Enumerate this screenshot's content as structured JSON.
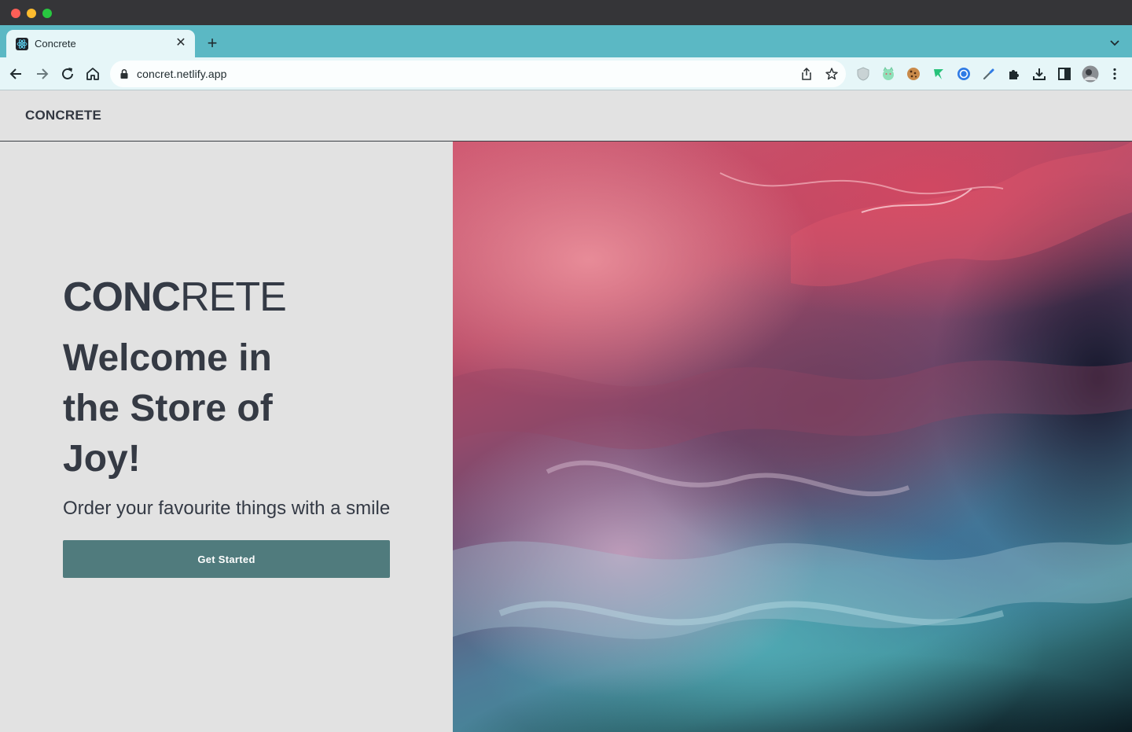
{
  "browser": {
    "tab_title": "Concrete",
    "url": "concret.netlify.app",
    "theme_color": "#5bb8c4"
  },
  "icons": {
    "tab_favicon": "react-atom-icon",
    "tab_close": "close-icon",
    "new_tab": "plus-icon",
    "tab_search": "chevron-down-icon",
    "back": "arrow-left-icon",
    "forward": "arrow-right-icon",
    "reload": "reload-icon",
    "home": "home-icon",
    "lock": "lock-icon",
    "share": "share-icon",
    "bookmark": "star-icon",
    "extensions": [
      "shield-extension-icon",
      "cat-extension-icon",
      "cookie-extension-icon",
      "green-extension-icon",
      "blue-circle-extension-icon",
      "eyedropper-extension-icon",
      "puzzle-icon",
      "download-icon",
      "sidepanel-icon",
      "avatar-icon",
      "kebab-menu-icon"
    ]
  },
  "site": {
    "logo": "CONCRETE",
    "brand_bold": "CONC",
    "brand_light": "RETE",
    "headline": "Welcome in the Store of Joy!",
    "tagline": "Order your favourite things with a smile",
    "cta_label": "Get Started",
    "accent_color": "#507b7d",
    "text_color": "#353a44"
  }
}
